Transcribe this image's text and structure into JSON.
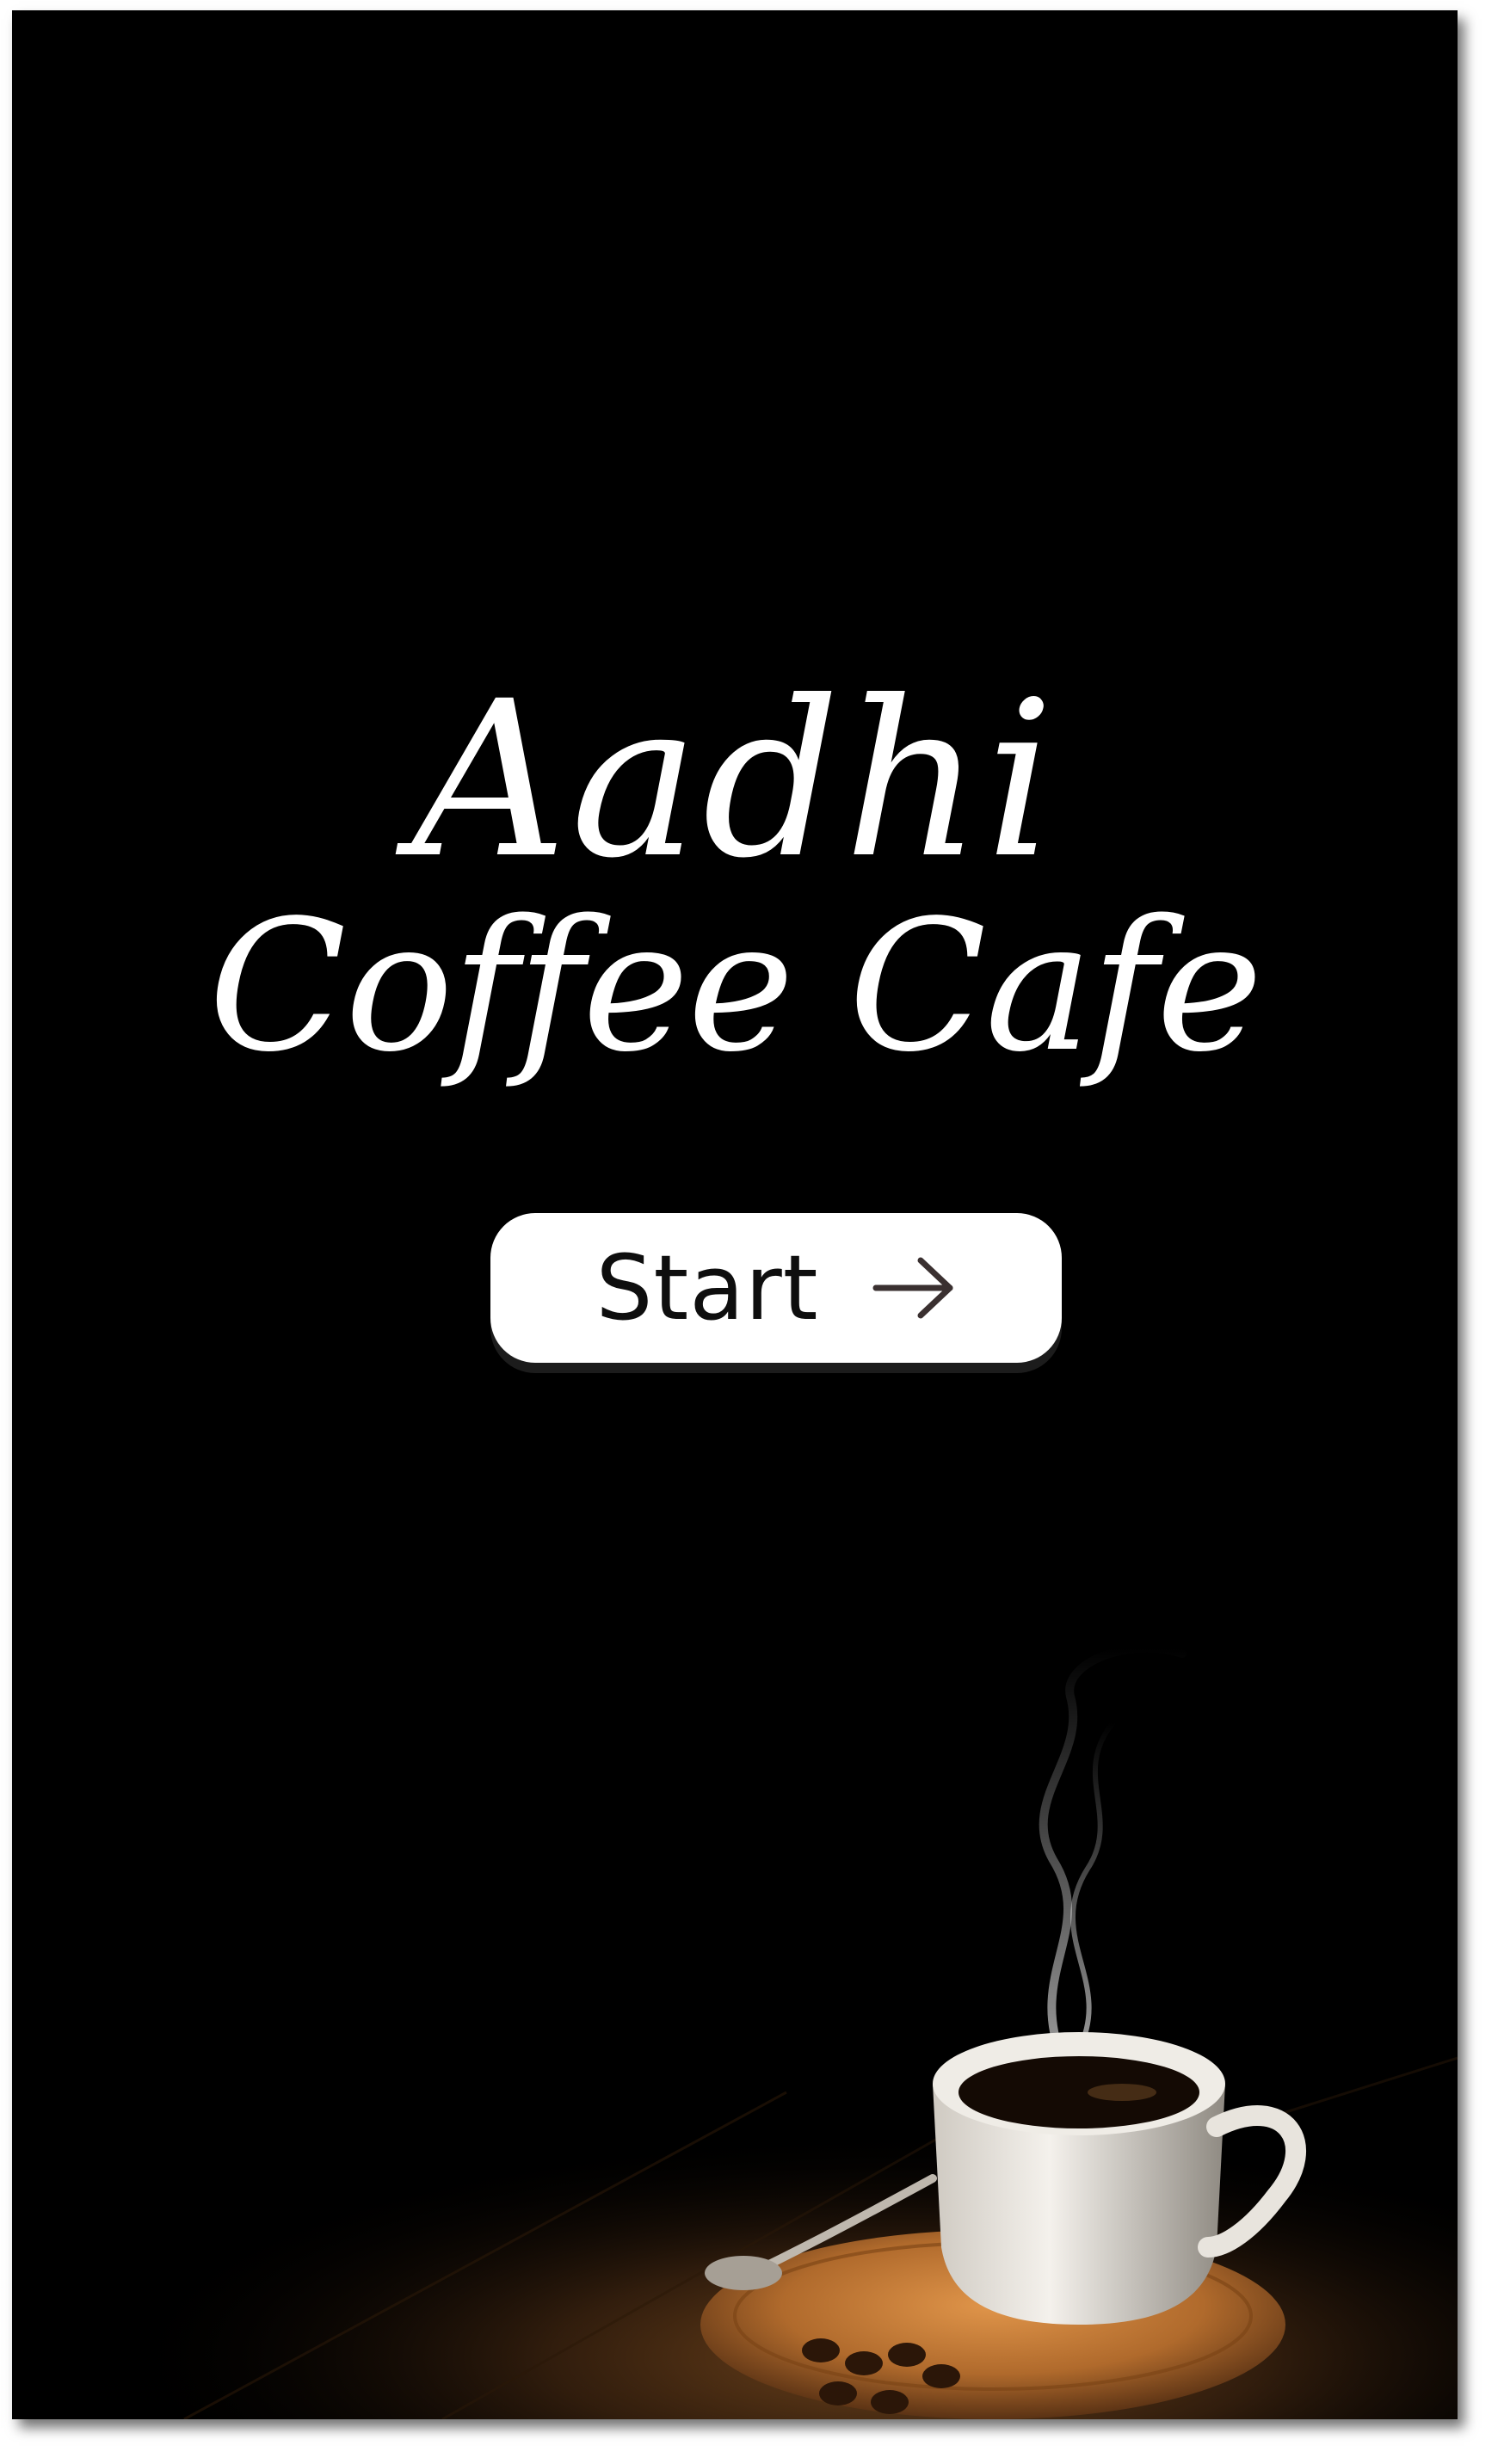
{
  "brand": {
    "line1": "Aadhi",
    "line2": "Coffee Cafe"
  },
  "start_button": {
    "label": "Start",
    "icon": "arrow-right-icon"
  },
  "illustration": {
    "subject": "steaming-coffee-cup-icon"
  },
  "colors": {
    "background": "#000000",
    "text": "#ffffff",
    "button_bg": "#ffffff",
    "button_text": "#0e0e0e",
    "wood": "#4a2c14",
    "saucer": "#b06a2c"
  }
}
